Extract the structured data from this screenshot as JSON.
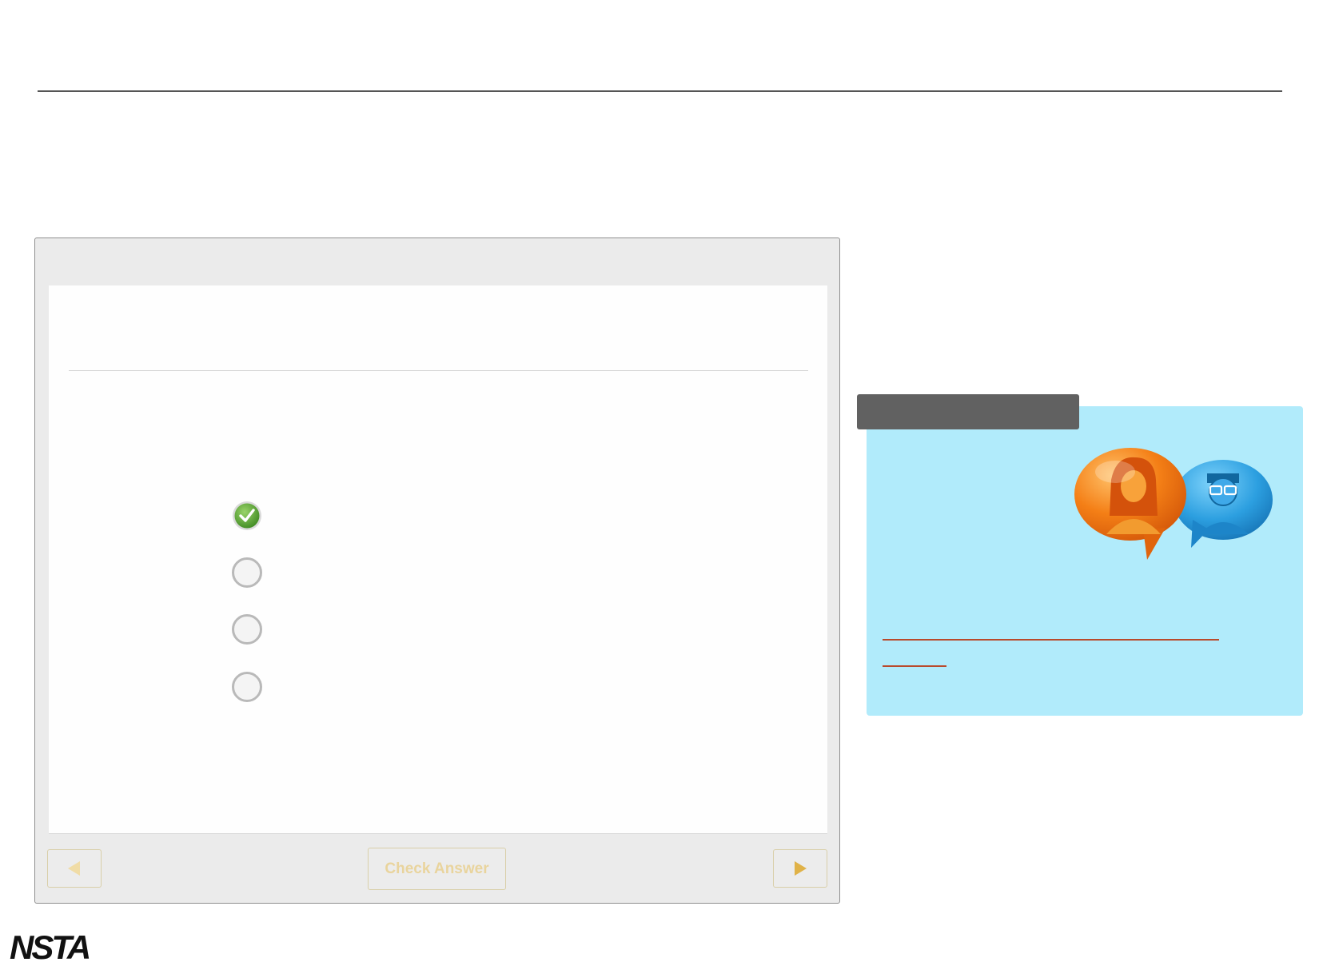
{
  "quiz": {
    "choices": [
      {
        "state": "correct",
        "icon": "check-circle-icon"
      },
      {
        "state": "unselected",
        "icon": "radio-empty-icon"
      },
      {
        "state": "unselected",
        "icon": "radio-empty-icon"
      },
      {
        "state": "unselected",
        "icon": "radio-empty-icon"
      }
    ],
    "check_label": "Check Answer",
    "prev_icon": "triangle-left-icon",
    "next_icon": "triangle-right-icon"
  },
  "discussion": {
    "art_icon": "discussion-people-bubbles-icon"
  },
  "footer": {
    "logo_text": "NSTA"
  },
  "colors": {
    "accent_gold": "#e0b248",
    "card_bg": "#b1ebfb",
    "tab_bg": "#616161",
    "correct_green": "#4c9a2a",
    "link_red": "#b94a2c"
  }
}
